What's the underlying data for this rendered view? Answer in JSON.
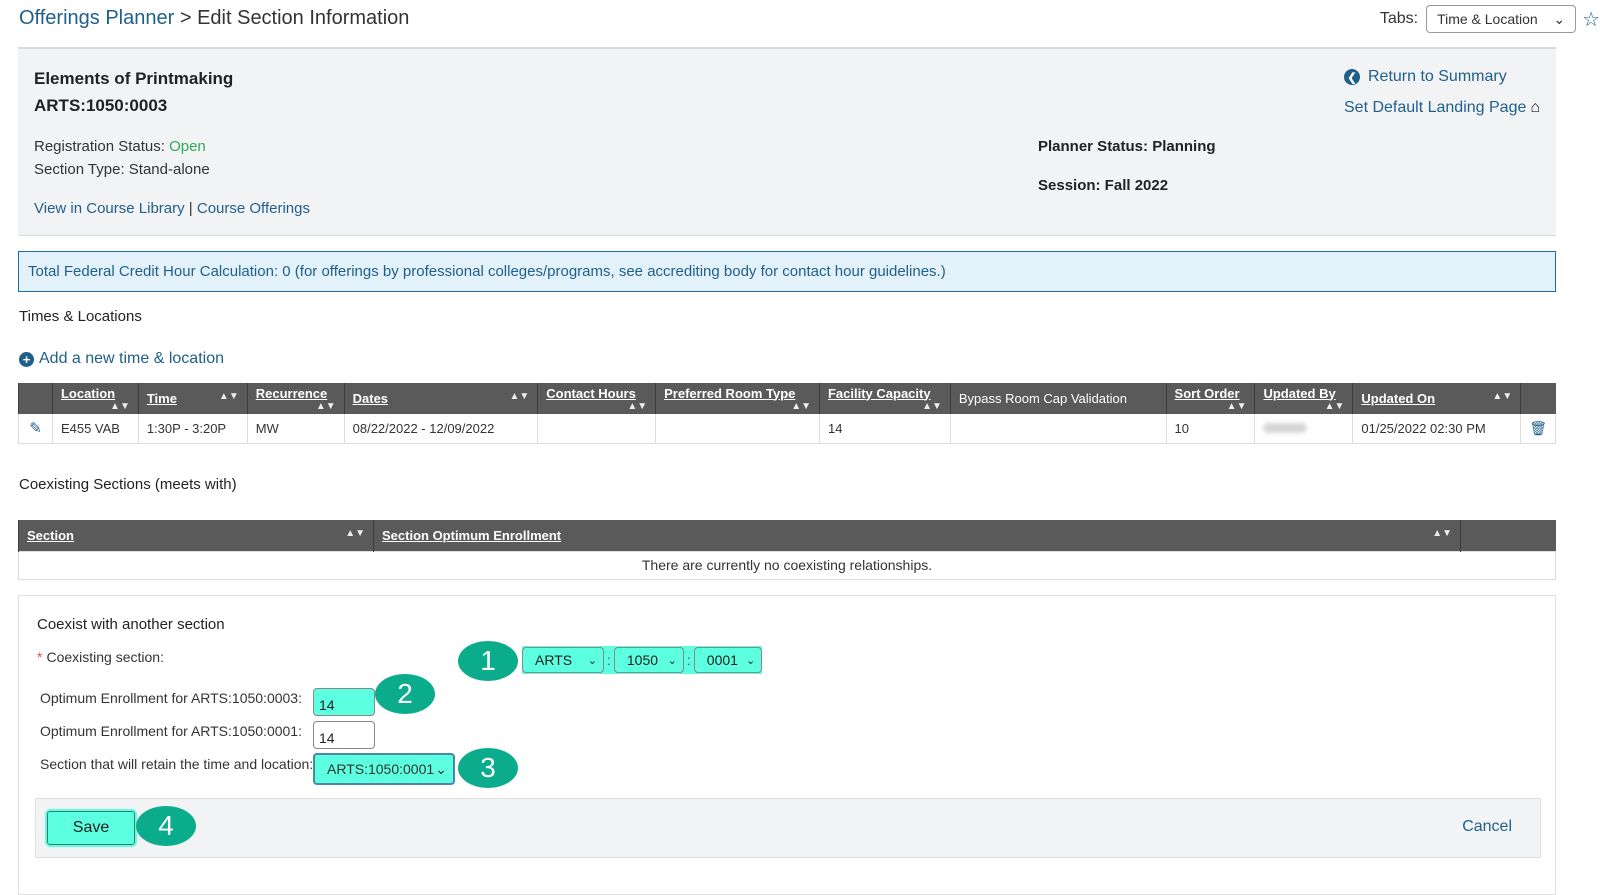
{
  "header": {
    "breadcrumb_link": "Offerings Planner",
    "breadcrumb_sep": " > ",
    "breadcrumb_current": "Edit Section Information",
    "tabs_label": "Tabs:",
    "tabs_selected": "Time & Location"
  },
  "course": {
    "title": "Elements of Printmaking",
    "code": "ARTS:1050:0003",
    "registration_status_label": "Registration Status: ",
    "registration_status_value": "Open",
    "section_type": "Section Type: Stand-alone",
    "view_library_link": "View in Course Library",
    "link_separator": " | ",
    "course_offerings_link": "Course Offerings",
    "planner_status": "Planner Status: Planning",
    "session": "Session: Fall 2022",
    "return_link": "Return to Summary",
    "landing_link": "Set Default Landing Page"
  },
  "alert": {
    "text": "Total Federal Credit Hour Calculation: 0 (for offerings by professional colleges/programs, see accrediting body for contact hour guidelines.)"
  },
  "times_locations": {
    "heading": "Times & Locations",
    "add_link": "Add a new time & location",
    "columns": [
      "Location",
      "Time",
      "Recurrence",
      "Dates",
      "Contact Hours",
      "Preferred Room Type",
      "Facility Capacity",
      "Bypass Room Cap Validation",
      "Sort Order",
      "Updated By",
      "Updated On"
    ],
    "rows": [
      {
        "location": "E455 VAB",
        "time": "1:30P - 3:20P",
        "recurrence": "MW",
        "dates": "08/22/2022 - 12/09/2022",
        "contact_hours": "",
        "preferred_room_type": "",
        "facility_capacity": "14",
        "bypass_room_cap": "",
        "sort_order": "10",
        "updated_by": "",
        "updated_on": "01/25/2022 02:30 PM"
      }
    ]
  },
  "coexisting": {
    "heading": "Coexisting Sections (meets with)",
    "columns": [
      "Section",
      "Section Optimum Enrollment"
    ],
    "empty_message": "There are currently no coexisting relationships."
  },
  "form": {
    "title": "Coexist with another section",
    "coexisting_label": "Coexisting section:",
    "subject_value": "ARTS",
    "course_value": "1050",
    "section_value": "0001",
    "opt_enroll_current_label": "Optimum Enrollment for ARTS:1050:0003:",
    "opt_enroll_current_value": "14",
    "opt_enroll_other_label": "Optimum Enrollment for ARTS:1050:0001:",
    "opt_enroll_other_value": "14",
    "retain_label": "Section that will retain the time and location:",
    "retain_value": "ARTS:1050:0001",
    "save_label": "Save",
    "cancel_label": "Cancel"
  },
  "annotations": [
    "1",
    "2",
    "3",
    "4"
  ]
}
